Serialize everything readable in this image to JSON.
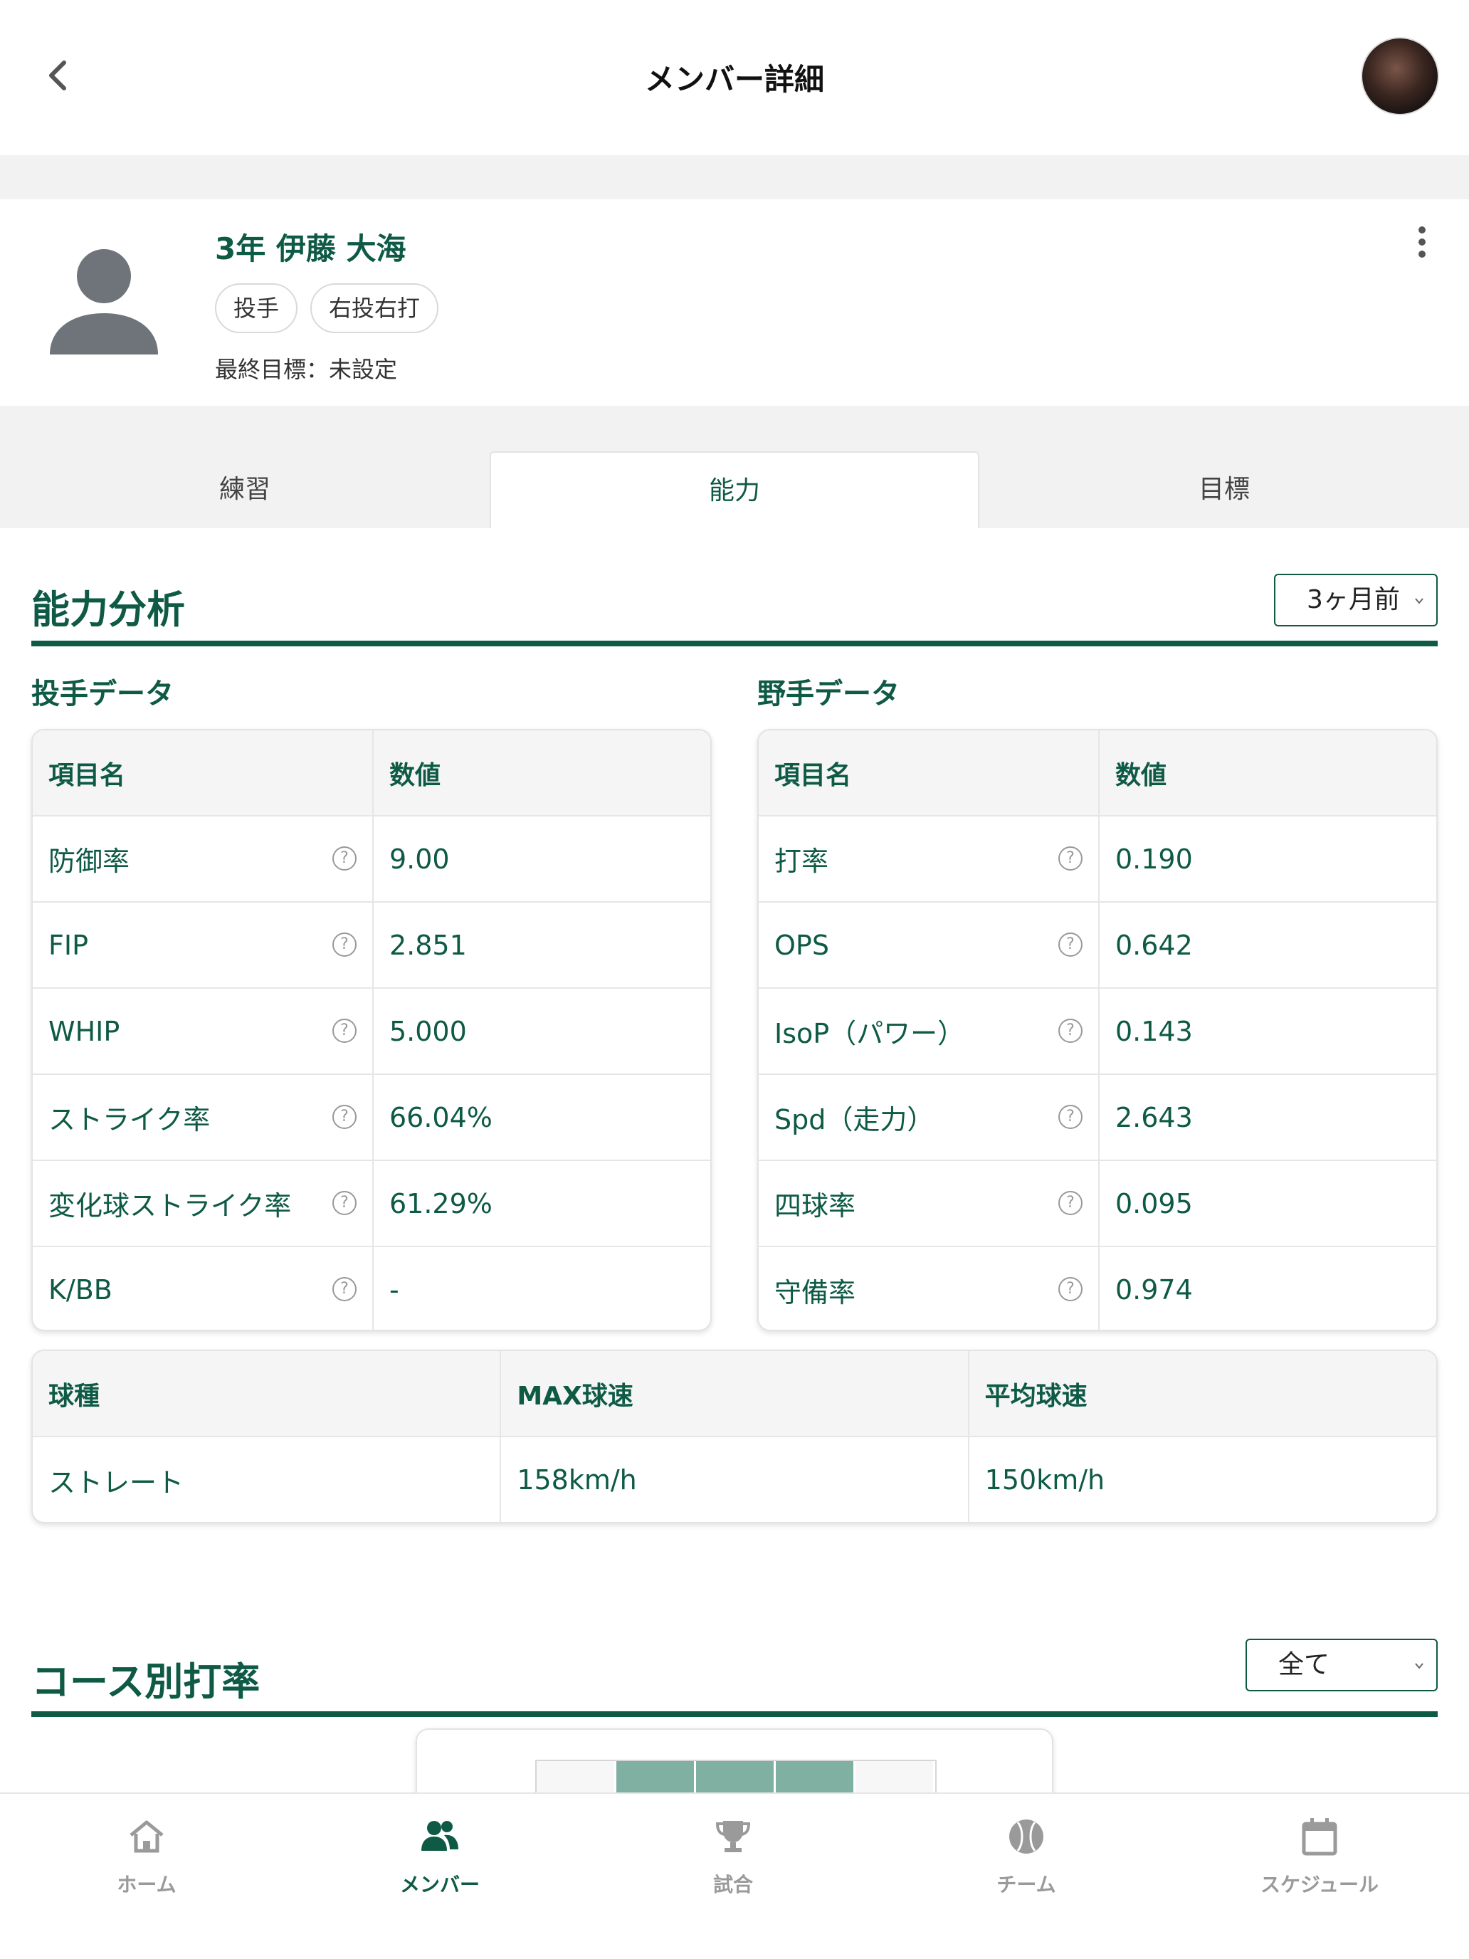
{
  "header": {
    "title": "メンバー詳細"
  },
  "profile": {
    "name": "3年 伊藤 大海",
    "tags": [
      "投手",
      "右投右打"
    ],
    "final_goal": "最終目標：未設定"
  },
  "tabs": [
    {
      "label": "練習"
    },
    {
      "label": "能力",
      "active": true
    },
    {
      "label": "目標"
    }
  ],
  "ability": {
    "title": "能力分析",
    "period": "3ヶ月前",
    "pitcher": {
      "title": "投手データ",
      "headers": [
        "項目名",
        "数値"
      ],
      "rows": [
        {
          "name": "防御率",
          "value": "9.00"
        },
        {
          "name": "FIP",
          "value": "2.851"
        },
        {
          "name": "WHIP",
          "value": "5.000"
        },
        {
          "name": "ストライク率",
          "value": "66.04%"
        },
        {
          "name": "変化球ストライク率",
          "value": "61.29%"
        },
        {
          "name": "K/BB",
          "value": "-"
        }
      ]
    },
    "fielder": {
      "title": "野手データ",
      "headers": [
        "項目名",
        "数値"
      ],
      "rows": [
        {
          "name": "打率",
          "value": "0.190"
        },
        {
          "name": "OPS",
          "value": "0.642"
        },
        {
          "name": "IsoP（パワー）",
          "value": "0.143"
        },
        {
          "name": "Spd（走力）",
          "value": "2.643"
        },
        {
          "name": "四球率",
          "value": "0.095"
        },
        {
          "name": "守備率",
          "value": "0.974"
        }
      ]
    },
    "pitch_types": {
      "headers": [
        "球種",
        "MAX球速",
        "平均球速"
      ],
      "rows": [
        {
          "type": "ストレート",
          "max": "158km/h",
          "avg": "150km/h"
        }
      ]
    }
  },
  "course": {
    "title": "コース別打率",
    "filter": "全て"
  },
  "nav": [
    {
      "label": "ホーム",
      "icon": "home-icon"
    },
    {
      "label": "メンバー",
      "icon": "members-icon",
      "active": true
    },
    {
      "label": "試合",
      "icon": "trophy-icon"
    },
    {
      "label": "チーム",
      "icon": "baseball-icon"
    },
    {
      "label": "スケジュール",
      "icon": "calendar-icon"
    }
  ],
  "colors": {
    "accent": "#0e5a45",
    "muted": "#9a9a9a",
    "zone_hit": "#7fb0a1"
  }
}
